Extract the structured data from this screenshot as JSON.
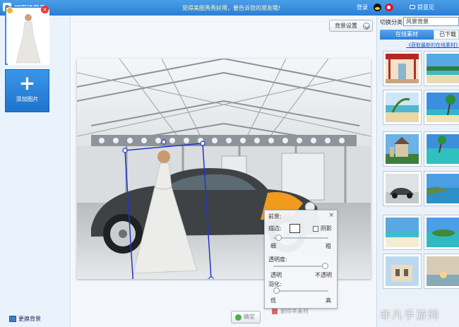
{
  "titlebar": {
    "title": "抠图换背景",
    "slogan": "觉得美图秀秀好用，要告诉您的朋友哦!",
    "login": "登录",
    "feedback": "提意见"
  },
  "left": {
    "add_photo": "添加图片",
    "change_background": "更换背景"
  },
  "center": {
    "bg_settings": "背景设置",
    "ok": "确定",
    "delete_material": "删除本素材"
  },
  "fore_panel": {
    "title": "前景:",
    "stroke": "描边:",
    "shadow": "阴影",
    "thin": "细",
    "thick": "粗",
    "opacity": "透明度:",
    "transparent": "透明",
    "opaque": "不透明",
    "feather": "羽化:",
    "low": "低",
    "high": "高",
    "stroke_level": 0.05,
    "opacity_level": 1.0,
    "feather_level": 0.0
  },
  "right": {
    "category_label": "切换分类",
    "category_value": "风景背景",
    "tab_online": "在线素材",
    "tab_downloaded": "已下载",
    "get_latest": "《获取最新的在线素材》"
  },
  "watermark": "非凡手游网"
}
